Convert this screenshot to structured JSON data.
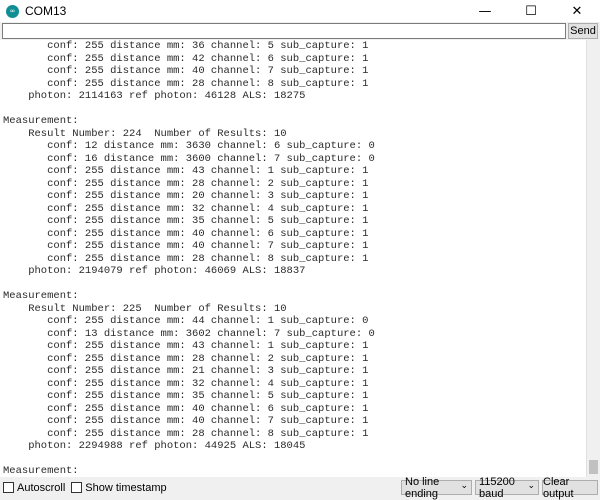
{
  "window": {
    "title": "COM13",
    "icon_glyph": "∞",
    "minimize_glyph": "—",
    "maximize_glyph": "☐",
    "close_glyph": "✕"
  },
  "send": {
    "input_value": "",
    "button_label": "Send"
  },
  "console_lines": [
    "       conf: 255 distance mm: 36 channel: 5 sub_capture: 1",
    "       conf: 255 distance mm: 42 channel: 6 sub_capture: 1",
    "       conf: 255 distance mm: 40 channel: 7 sub_capture: 1",
    "       conf: 255 distance mm: 28 channel: 8 sub_capture: 1",
    "    photon: 2114163 ref photon: 46128 ALS: 18275",
    "",
    "Measurement:",
    "    Result Number: 224  Number of Results: 10",
    "       conf: 12 distance mm: 3630 channel: 6 sub_capture: 0",
    "       conf: 16 distance mm: 3600 channel: 7 sub_capture: 0",
    "       conf: 255 distance mm: 43 channel: 1 sub_capture: 1",
    "       conf: 255 distance mm: 28 channel: 2 sub_capture: 1",
    "       conf: 255 distance mm: 20 channel: 3 sub_capture: 1",
    "       conf: 255 distance mm: 32 channel: 4 sub_capture: 1",
    "       conf: 255 distance mm: 35 channel: 5 sub_capture: 1",
    "       conf: 255 distance mm: 40 channel: 6 sub_capture: 1",
    "       conf: 255 distance mm: 40 channel: 7 sub_capture: 1",
    "       conf: 255 distance mm: 28 channel: 8 sub_capture: 1",
    "    photon: 2194079 ref photon: 46069 ALS: 18837",
    "",
    "Measurement:",
    "    Result Number: 225  Number of Results: 10",
    "       conf: 255 distance mm: 44 channel: 1 sub_capture: 0",
    "       conf: 13 distance mm: 3602 channel: 7 sub_capture: 0",
    "       conf: 255 distance mm: 43 channel: 1 sub_capture: 1",
    "       conf: 255 distance mm: 28 channel: 2 sub_capture: 1",
    "       conf: 255 distance mm: 21 channel: 3 sub_capture: 1",
    "       conf: 255 distance mm: 32 channel: 4 sub_capture: 1",
    "       conf: 255 distance mm: 35 channel: 5 sub_capture: 1",
    "       conf: 255 distance mm: 40 channel: 6 sub_capture: 1",
    "       conf: 255 distance mm: 40 channel: 7 sub_capture: 1",
    "       conf: 255 distance mm: 28 channel: 8 sub_capture: 1",
    "    photon: 2294988 ref photon: 44925 ALS: 18045",
    "",
    "Measurement:"
  ],
  "footer": {
    "autoscroll_label": "Autoscroll",
    "timestamp_label": "Show timestamp",
    "line_ending": "No line ending",
    "baud": "115200 baud",
    "clear_label": "Clear output",
    "caret_glyph": "⌄"
  }
}
